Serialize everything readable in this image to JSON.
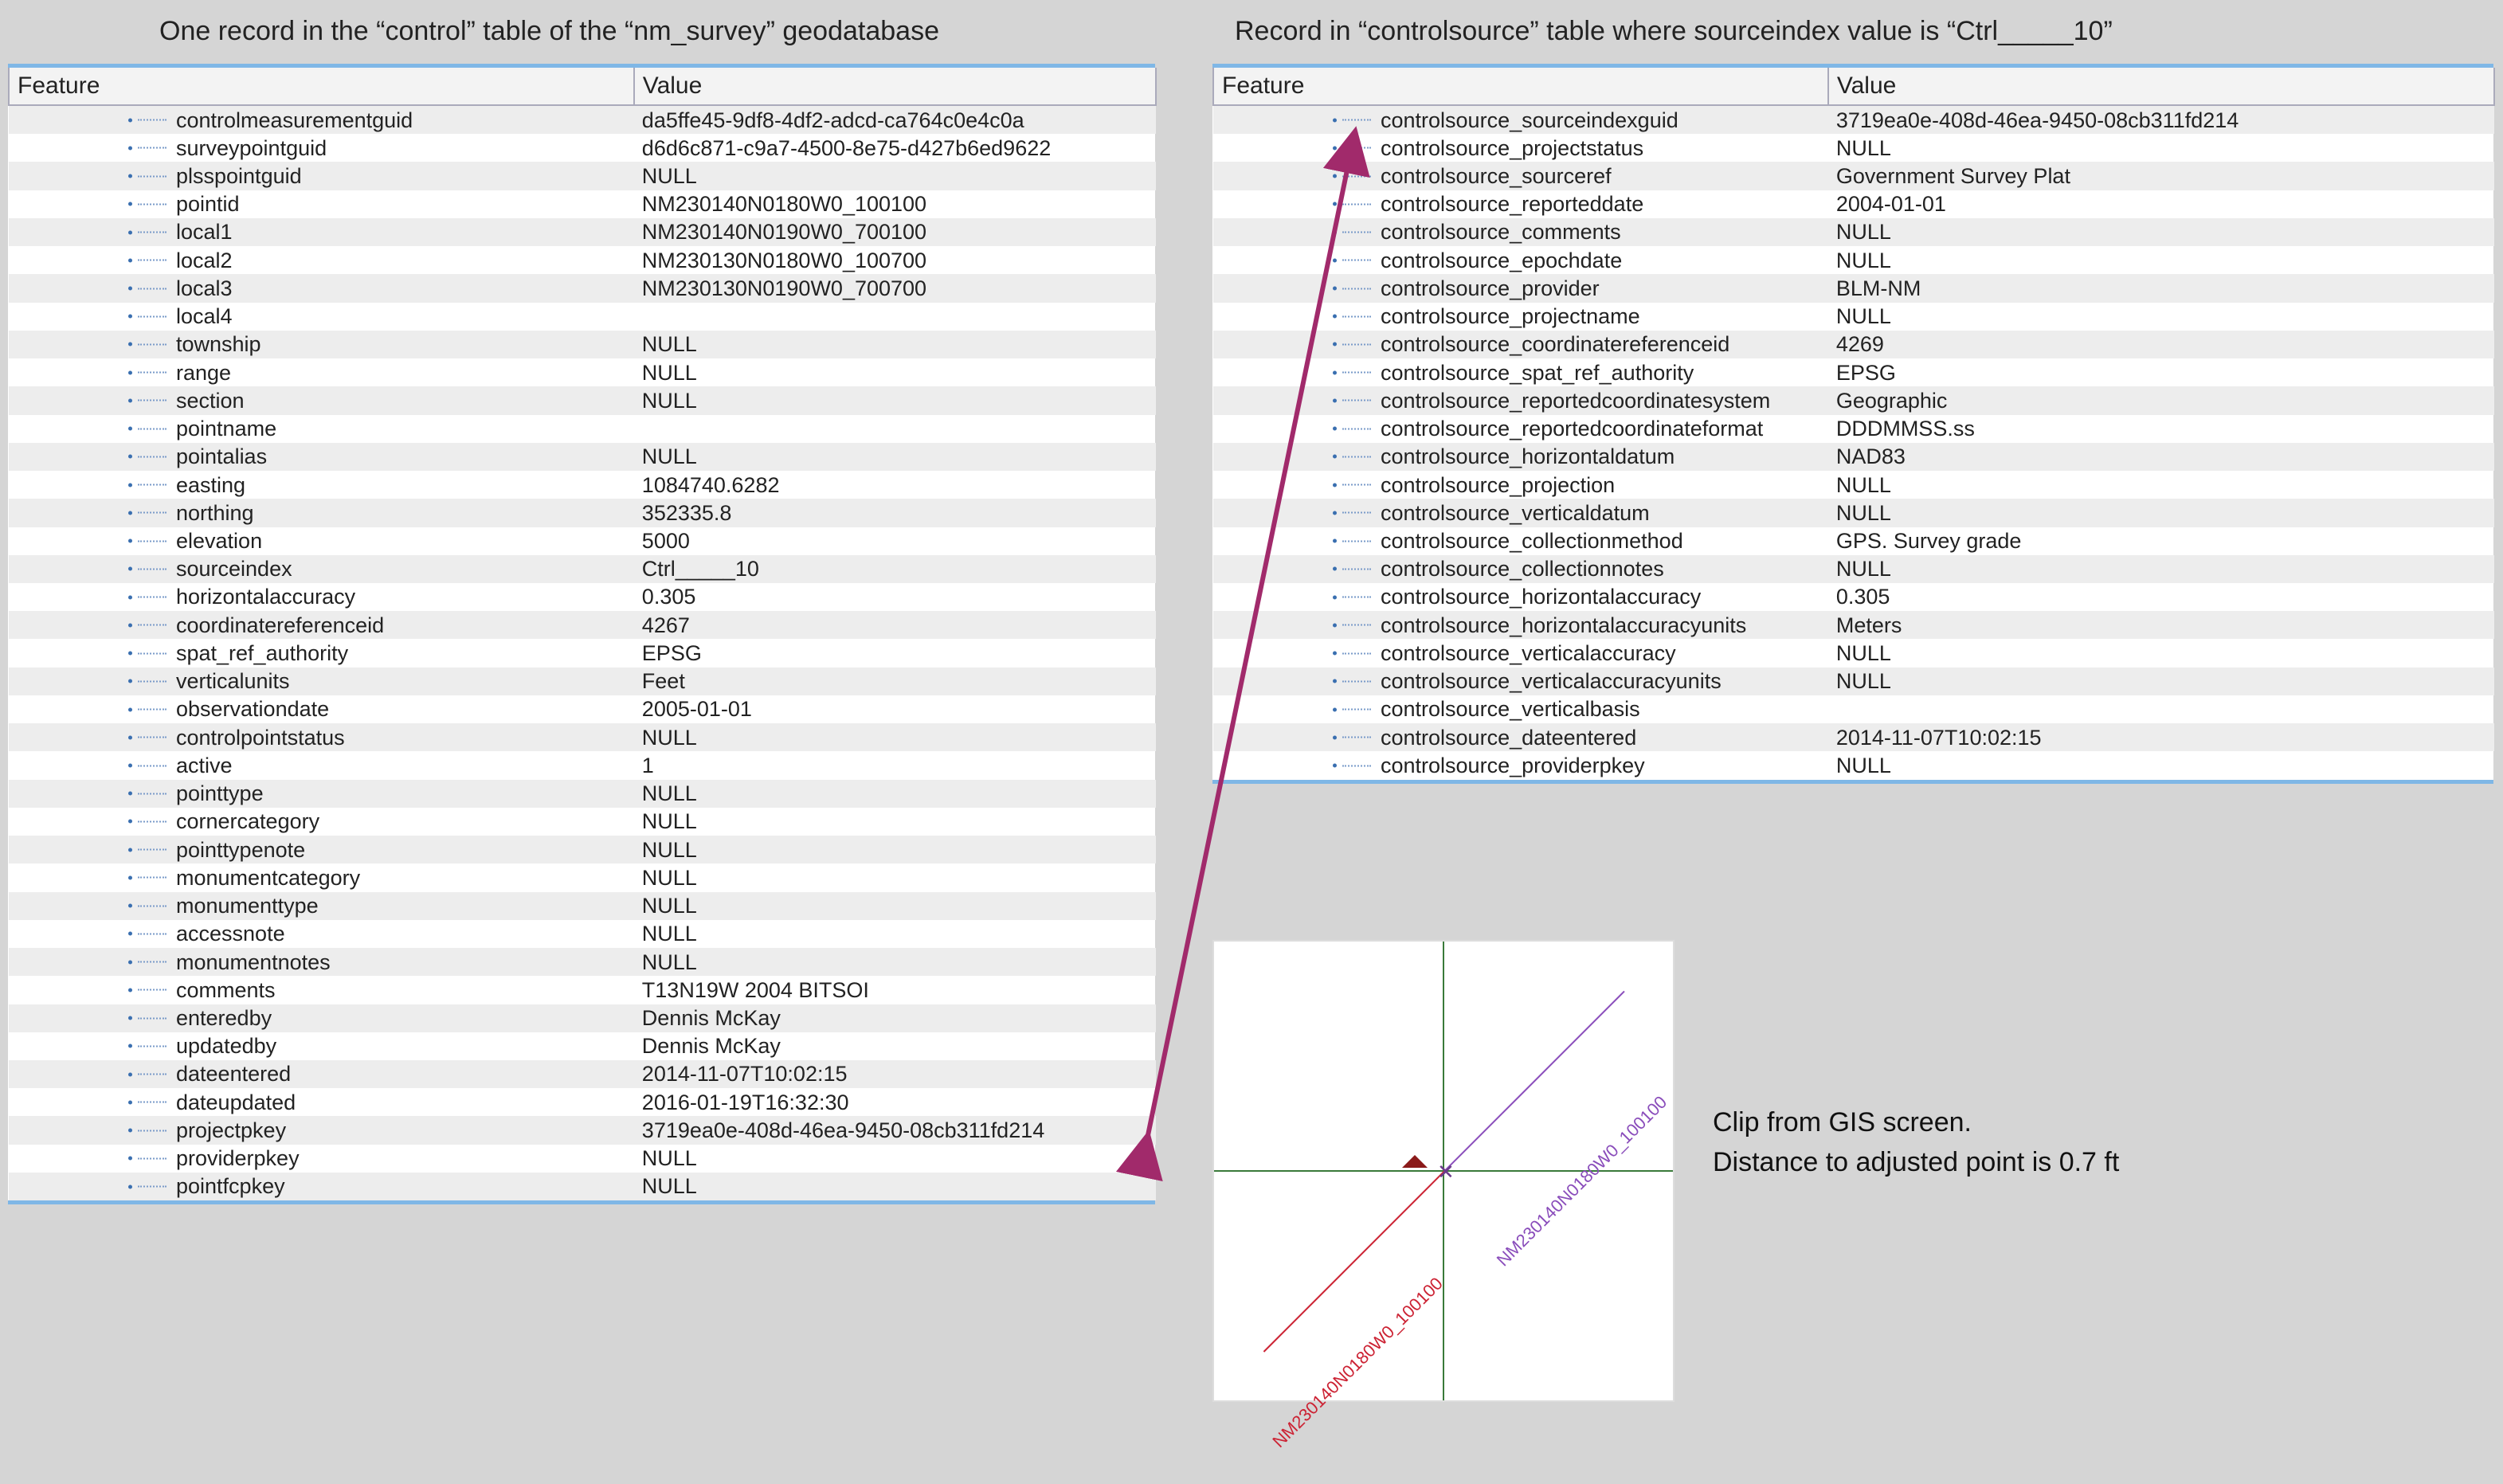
{
  "captions": {
    "left": "One record in the “control” table of the “nm_survey” geodatabase",
    "right": "Record in “controlsource” table where  sourceindex value is “Ctrl_____10”"
  },
  "headers": {
    "feature": "Feature",
    "value": "Value"
  },
  "controlTable": [
    {
      "k": "controlmeasurementguid",
      "v": "da5ffe45-9df8-4df2-adcd-ca764c0e4c0a"
    },
    {
      "k": "surveypointguid",
      "v": "d6d6c871-c9a7-4500-8e75-d427b6ed9622"
    },
    {
      "k": "plsspointguid",
      "v": "NULL"
    },
    {
      "k": "pointid",
      "v": "NM230140N0180W0_100100"
    },
    {
      "k": "local1",
      "v": "NM230140N0190W0_700100"
    },
    {
      "k": "local2",
      "v": "NM230130N0180W0_100700"
    },
    {
      "k": "local3",
      "v": "NM230130N0190W0_700700"
    },
    {
      "k": "local4",
      "v": ""
    },
    {
      "k": "township",
      "v": "NULL"
    },
    {
      "k": "range",
      "v": "NULL"
    },
    {
      "k": "section",
      "v": "NULL"
    },
    {
      "k": "pointname",
      "v": ""
    },
    {
      "k": "pointalias",
      "v": "NULL"
    },
    {
      "k": "easting",
      "v": "1084740.6282"
    },
    {
      "k": "northing",
      "v": "352335.8"
    },
    {
      "k": "elevation",
      "v": "5000"
    },
    {
      "k": "sourceindex",
      "v": "Ctrl_____10"
    },
    {
      "k": "horizontalaccuracy",
      "v": "0.305"
    },
    {
      "k": "coordinatereferenceid",
      "v": "4267"
    },
    {
      "k": "spat_ref_authority",
      "v": "EPSG"
    },
    {
      "k": "verticalunits",
      "v": "Feet"
    },
    {
      "k": "observationdate",
      "v": "2005-01-01"
    },
    {
      "k": "controlpointstatus",
      "v": "NULL"
    },
    {
      "k": "active",
      "v": "1"
    },
    {
      "k": "pointtype",
      "v": "NULL"
    },
    {
      "k": "cornercategory",
      "v": "NULL"
    },
    {
      "k": "pointtypenote",
      "v": "NULL"
    },
    {
      "k": "monumentcategory",
      "v": "NULL"
    },
    {
      "k": "monumenttype",
      "v": "NULL"
    },
    {
      "k": "accessnote",
      "v": "NULL"
    },
    {
      "k": "monumentnotes",
      "v": "NULL"
    },
    {
      "k": "comments",
      "v": "   T13N19W 2004 BITSOI"
    },
    {
      "k": "enteredby",
      "v": "Dennis McKay"
    },
    {
      "k": "updatedby",
      "v": "Dennis McKay"
    },
    {
      "k": "dateentered",
      "v": "2014-11-07T10:02:15"
    },
    {
      "k": "dateupdated",
      "v": "2016-01-19T16:32:30"
    },
    {
      "k": "projectpkey",
      "v": "3719ea0e-408d-46ea-9450-08cb311fd214"
    },
    {
      "k": "providerpkey",
      "v": "NULL"
    },
    {
      "k": "pointfcpkey",
      "v": "NULL"
    }
  ],
  "sourceTable": [
    {
      "k": "controlsource_sourceindexguid",
      "v": "3719ea0e-408d-46ea-9450-08cb311fd214"
    },
    {
      "k": "controlsource_projectstatus",
      "v": "NULL"
    },
    {
      "k": "controlsource_sourceref",
      "v": "Government Survey Plat"
    },
    {
      "k": "controlsource_reporteddate",
      "v": "2004-01-01"
    },
    {
      "k": "controlsource_comments",
      "v": "NULL"
    },
    {
      "k": "controlsource_epochdate",
      "v": "NULL"
    },
    {
      "k": "controlsource_provider",
      "v": "BLM-NM"
    },
    {
      "k": "controlsource_projectname",
      "v": "NULL"
    },
    {
      "k": "controlsource_coordinatereferenceid",
      "v": "4269"
    },
    {
      "k": "controlsource_spat_ref_authority",
      "v": "EPSG"
    },
    {
      "k": "controlsource_reportedcoordinatesystem",
      "v": "Geographic"
    },
    {
      "k": "controlsource_reportedcoordinateformat",
      "v": "DDDMMSS.ss"
    },
    {
      "k": "controlsource_horizontaldatum",
      "v": "NAD83"
    },
    {
      "k": "controlsource_projection",
      "v": "NULL"
    },
    {
      "k": "controlsource_verticaldatum",
      "v": "NULL"
    },
    {
      "k": "controlsource_collectionmethod",
      "v": "GPS. Survey grade"
    },
    {
      "k": "controlsource_collectionnotes",
      "v": "NULL"
    },
    {
      "k": "controlsource_horizontalaccuracy",
      "v": "0.305"
    },
    {
      "k": "controlsource_horizontalaccuracyunits",
      "v": "Meters"
    },
    {
      "k": "controlsource_verticalaccuracy",
      "v": "NULL"
    },
    {
      "k": "controlsource_verticalaccuracyunits",
      "v": "NULL"
    },
    {
      "k": "controlsource_verticalbasis",
      "v": ""
    },
    {
      "k": "controlsource_dateentered",
      "v": "2014-11-07T10:02:15"
    },
    {
      "k": "controlsource_providerpkey",
      "v": "NULL"
    }
  ],
  "map": {
    "labelUpper": "NM230140N0180W0_100100",
    "labelLower": "NM230140N0180W0_100100"
  },
  "notes": {
    "line1": "Clip from GIS screen.",
    "line2": "Distance to adjusted point is 0.7 ft"
  }
}
